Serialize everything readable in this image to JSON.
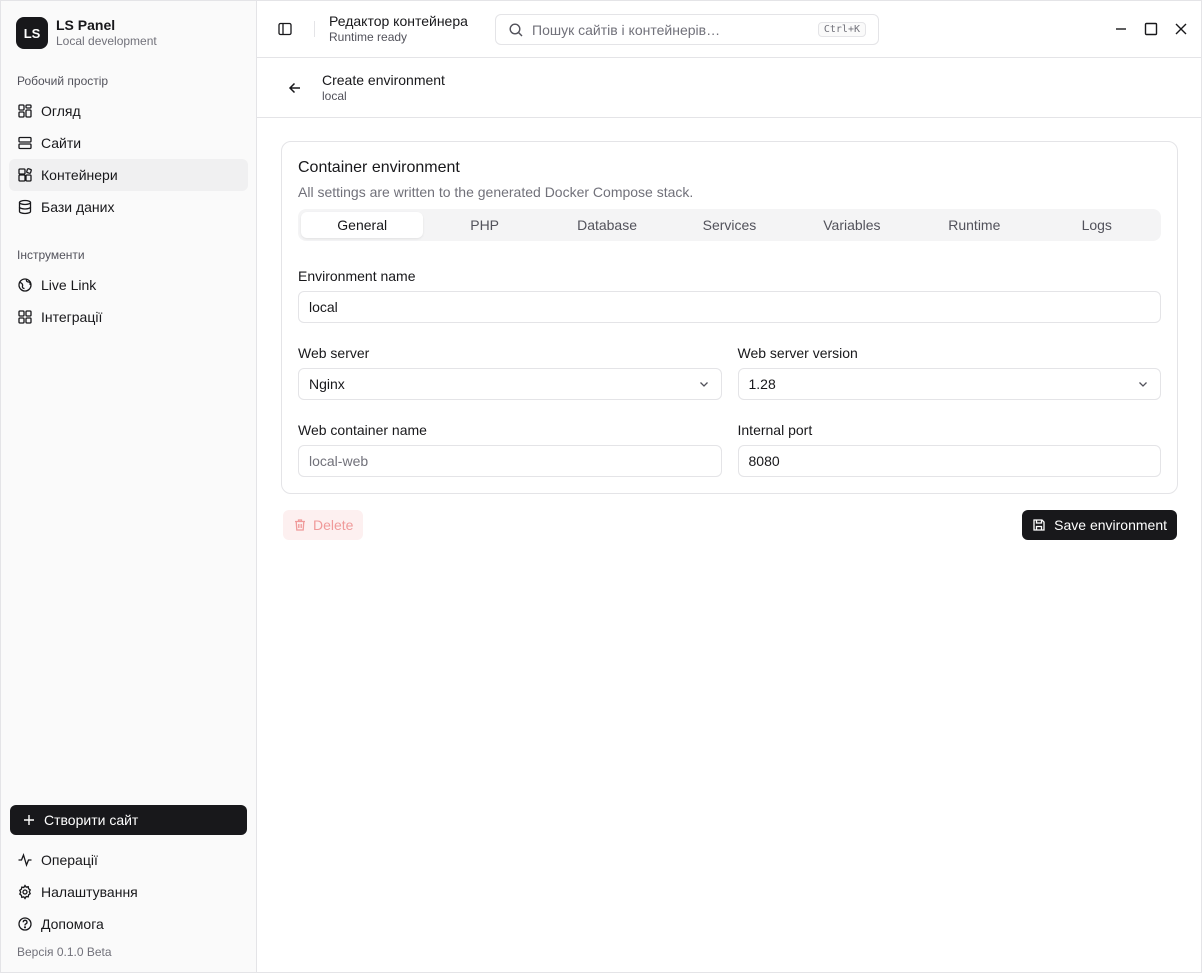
{
  "brand": {
    "logo": "LS",
    "title": "LS Panel",
    "subtitle": "Local development"
  },
  "sidebar": {
    "workspace_label": "Робочий простір",
    "workspace_items": [
      {
        "label": "Огляд",
        "icon": "dashboard-icon"
      },
      {
        "label": "Сайти",
        "icon": "server-icon"
      },
      {
        "label": "Контейнери",
        "icon": "containers-icon",
        "active": true
      },
      {
        "label": "Бази даних",
        "icon": "database-icon"
      }
    ],
    "tools_label": "Інструменти",
    "tools_items": [
      {
        "label": "Live Link",
        "icon": "globe-icon"
      },
      {
        "label": "Інтеграції",
        "icon": "grid-icon"
      }
    ],
    "create_button": "Створити сайт",
    "bottom_items": [
      {
        "label": "Операції",
        "icon": "activity-icon"
      },
      {
        "label": "Налаштування",
        "icon": "gear-icon"
      },
      {
        "label": "Допомога",
        "icon": "help-icon"
      }
    ],
    "version": "Версія 0.1.0 Beta"
  },
  "topbar": {
    "title": "Редактор контейнера",
    "subtitle": "Runtime ready",
    "search_placeholder": "Пошук сайтів і контейнерів…",
    "search_shortcut": "Ctrl+K"
  },
  "page": {
    "title": "Create environment",
    "subtitle": "local"
  },
  "card": {
    "title": "Container environment",
    "description": "All settings are written to the generated Docker Compose stack.",
    "tabs": [
      "General",
      "PHP",
      "Database",
      "Services",
      "Variables",
      "Runtime",
      "Logs"
    ],
    "active_tab": "General"
  },
  "form": {
    "env_name_label": "Environment name",
    "env_name_value": "local",
    "web_server_label": "Web server",
    "web_server_value": "Nginx",
    "web_server_version_label": "Web server version",
    "web_server_version_value": "1.28",
    "web_container_label": "Web container name",
    "web_container_placeholder": "local-web",
    "internal_port_label": "Internal port",
    "internal_port_value": "8080"
  },
  "actions": {
    "delete": "Delete",
    "save": "Save environment"
  }
}
